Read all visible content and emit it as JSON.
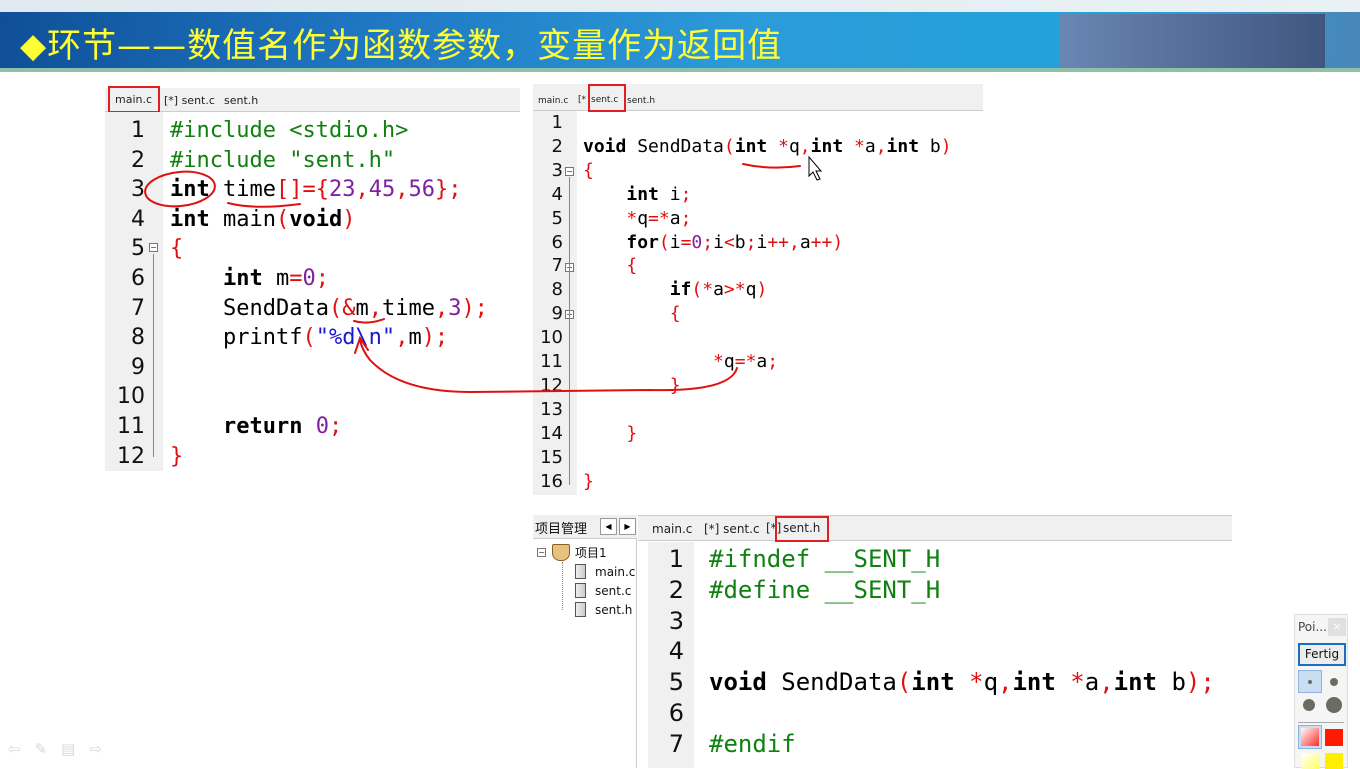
{
  "slide": {
    "title": "◆环节——数值名作为函数参数，变量作为返回值"
  },
  "left_editor": {
    "tabs": [
      "main.c",
      "[*] sent.c",
      "sent.h"
    ],
    "active_tab": "main.c",
    "lines": [
      [
        [
          "#include <stdio.h>",
          "pp"
        ]
      ],
      [
        [
          "#include \"sent.h\"",
          "pp"
        ]
      ],
      [
        [
          "int",
          "kw"
        ],
        [
          " time",
          "tx"
        ],
        [
          "[]={",
          "op"
        ],
        [
          "23",
          "num"
        ],
        [
          ",",
          "op"
        ],
        [
          "45",
          "num"
        ],
        [
          ",",
          "op"
        ],
        [
          "56",
          "num"
        ],
        [
          "};",
          "op"
        ]
      ],
      [
        [
          "int",
          "kw"
        ],
        [
          " main",
          "tx"
        ],
        [
          "(",
          "op"
        ],
        [
          "void",
          "kw"
        ],
        [
          ")",
          "op"
        ]
      ],
      [
        [
          "{",
          "op"
        ]
      ],
      [
        [
          "    ",
          "tx"
        ],
        [
          "int",
          "kw"
        ],
        [
          " m",
          "tx"
        ],
        [
          "=",
          "op"
        ],
        [
          "0",
          "num"
        ],
        [
          ";",
          "op"
        ]
      ],
      [
        [
          "    SendData",
          "tx"
        ],
        [
          "(&",
          "op"
        ],
        [
          "m",
          "tx"
        ],
        [
          ",",
          "op"
        ],
        [
          "time",
          "tx"
        ],
        [
          ",",
          "op"
        ],
        [
          "3",
          "num"
        ],
        [
          ");",
          "op"
        ]
      ],
      [
        [
          "    printf",
          "tx"
        ],
        [
          "(",
          "op"
        ],
        [
          "\"%d\\n\"",
          "str"
        ],
        [
          ",",
          "op"
        ],
        [
          "m",
          "tx"
        ],
        [
          ");",
          "op"
        ]
      ],
      [],
      [],
      [
        [
          "    ",
          "tx"
        ],
        [
          "return",
          "kw"
        ],
        [
          " ",
          "tx"
        ],
        [
          "0",
          "num"
        ],
        [
          ";",
          "op"
        ]
      ],
      [
        [
          "}",
          "op"
        ]
      ]
    ]
  },
  "right_editor": {
    "tabs": [
      "main.c",
      "[*",
      "sent.c",
      "sent.h"
    ],
    "active_tab": "sent.c",
    "lines": [
      [],
      [
        [
          "void",
          "kw"
        ],
        [
          " SendData",
          "tx"
        ],
        [
          "(",
          "op"
        ],
        [
          "int",
          "kw"
        ],
        [
          " ",
          "tx"
        ],
        [
          "*",
          "op"
        ],
        [
          "q",
          ""
        ],
        [
          ",",
          "op"
        ],
        [
          "int",
          "kw"
        ],
        [
          " ",
          "tx"
        ],
        [
          "*",
          "op"
        ],
        [
          "a",
          "tx"
        ],
        [
          ",",
          "op"
        ],
        [
          "int",
          "kw"
        ],
        [
          " b",
          "tx"
        ],
        [
          ")",
          "op"
        ]
      ],
      [
        [
          "{",
          "op"
        ]
      ],
      [
        [
          "    ",
          "tx"
        ],
        [
          "int",
          "kw"
        ],
        [
          " i",
          "tx"
        ],
        [
          ";",
          "op"
        ]
      ],
      [
        [
          "    ",
          "tx"
        ],
        [
          "*",
          "op"
        ],
        [
          "q",
          "tx"
        ],
        [
          "=*",
          "op"
        ],
        [
          "a",
          "tx"
        ],
        [
          ";",
          "op"
        ]
      ],
      [
        [
          "    ",
          "tx"
        ],
        [
          "for",
          "kw"
        ],
        [
          "(",
          "op"
        ],
        [
          "i",
          "tx"
        ],
        [
          "=",
          "op"
        ],
        [
          "0",
          "num"
        ],
        [
          ";",
          "op"
        ],
        [
          "i",
          "tx"
        ],
        [
          "<",
          "op"
        ],
        [
          "b",
          "tx"
        ],
        [
          ";",
          "op"
        ],
        [
          "i",
          "tx"
        ],
        [
          "++,",
          "op"
        ],
        [
          "a",
          "tx"
        ],
        [
          "++)",
          "op"
        ]
      ],
      [
        [
          "    {",
          "op"
        ]
      ],
      [
        [
          "        ",
          "tx"
        ],
        [
          "if",
          "kw"
        ],
        [
          "(*",
          "op"
        ],
        [
          "a",
          "tx"
        ],
        [
          ">*",
          "op"
        ],
        [
          "q",
          "tx"
        ],
        [
          ")",
          "op"
        ]
      ],
      [
        [
          "        {",
          "op"
        ]
      ],
      [],
      [
        [
          "            ",
          "tx"
        ],
        [
          "*",
          "op"
        ],
        [
          "q",
          "tx"
        ],
        [
          "=*",
          "op"
        ],
        [
          "a",
          "tx"
        ],
        [
          ";",
          "op"
        ]
      ],
      [
        [
          "        }",
          "op"
        ]
      ],
      [],
      [
        [
          "    }",
          "op"
        ]
      ],
      [],
      [
        [
          "}",
          "op"
        ]
      ]
    ]
  },
  "project_panel": {
    "title": "项目管理",
    "project": "项目1",
    "files": [
      "main.c",
      "sent.c",
      "sent.h"
    ]
  },
  "bottom_editor": {
    "tabs": [
      "main.c",
      "[*] sent.c",
      "[*]",
      "sent.h"
    ],
    "active_tab": "sent.h",
    "lines": [
      [
        [
          "#ifndef __SENT_H",
          "pp"
        ]
      ],
      [
        [
          "#define __SENT_H",
          "pp"
        ]
      ],
      [],
      [],
      [
        [
          "void",
          "kw"
        ],
        [
          " SendData",
          "tx"
        ],
        [
          "(",
          "op"
        ],
        [
          "int",
          "kw"
        ],
        [
          " ",
          "tx"
        ],
        [
          "*",
          "op"
        ],
        [
          "q",
          "tx"
        ],
        [
          ",",
          "op"
        ],
        [
          "int",
          "kw"
        ],
        [
          " ",
          "tx"
        ],
        [
          "*",
          "op"
        ],
        [
          "a",
          "tx"
        ],
        [
          ",",
          "op"
        ],
        [
          "int",
          "kw"
        ],
        [
          " b",
          "tx"
        ],
        [
          ");",
          "op"
        ]
      ],
      [],
      [
        [
          "#endif",
          "pp"
        ]
      ]
    ]
  },
  "pointer_tool": {
    "title": "Poi...",
    "close": "×",
    "done_label": "Fertig",
    "colors": [
      "#ff2a2a",
      "#ff1a00",
      "#ffff99",
      "#ffee00"
    ]
  },
  "annotation_color": "#e01010"
}
